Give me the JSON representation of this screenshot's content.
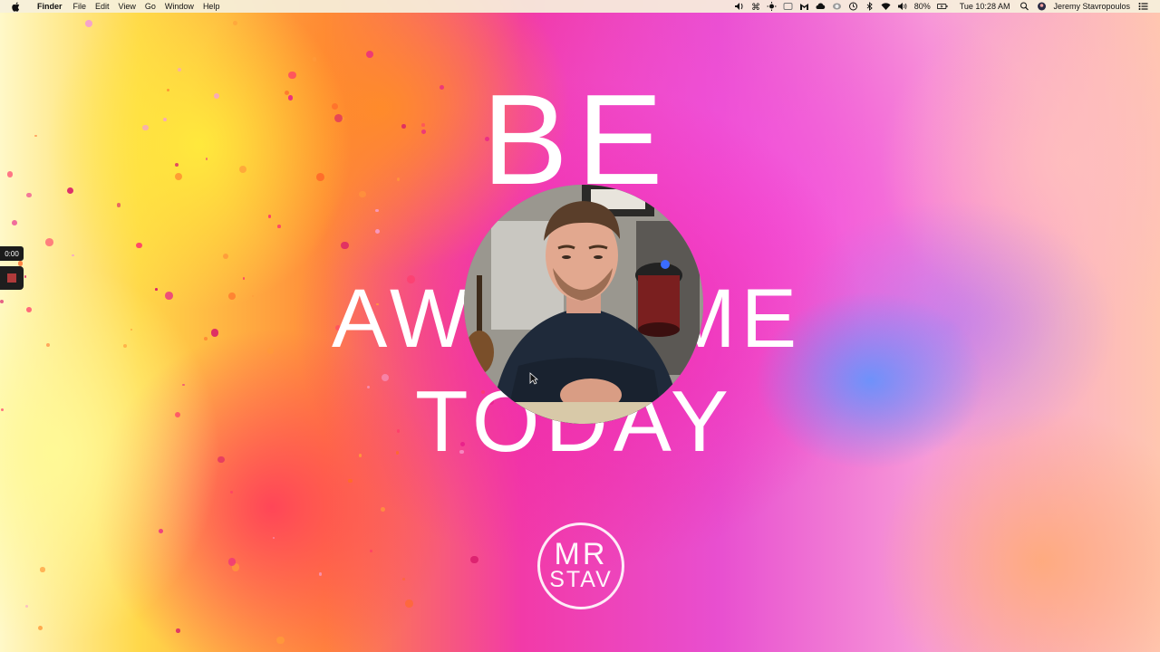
{
  "menubar": {
    "app_name": "Finder",
    "menus": [
      "File",
      "Edit",
      "View",
      "Go",
      "Window",
      "Help"
    ],
    "status": {
      "battery_percent": "80%",
      "clock": "Tue 10:28 AM",
      "user_name": "Jeremy Stavropoulos"
    },
    "status_icons": [
      "audio-hijack-icon",
      "command-icon",
      "brightness-icon",
      "screen-icon",
      "malwarebytes-icon",
      "cloud-icon",
      "toggle-icon",
      "time-machine-icon",
      "bluetooth-icon",
      "wifi-icon",
      "volume-icon",
      "battery-icon",
      "spotlight-icon",
      "user-avatar-icon",
      "notification-center-icon"
    ]
  },
  "wallpaper": {
    "line1": "BE",
    "line2": "AWESOME",
    "line3": "TODAY",
    "logo_line1": "MR",
    "logo_line2": "STAV"
  },
  "recording": {
    "timer": "0:00",
    "stop_color": "#b03a3a"
  },
  "colors": {
    "menubar_bg": "#f6f0dc",
    "text_white": "#ffffff",
    "magenta": "#f23aa8",
    "yellow": "#ffd84a"
  }
}
